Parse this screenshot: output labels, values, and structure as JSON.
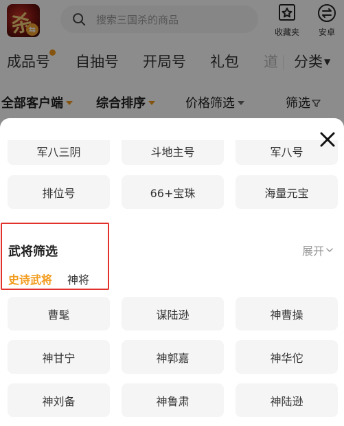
{
  "header": {
    "search_placeholder": "搜索三国杀的商品",
    "actions": [
      {
        "label": "收藏夹",
        "icon": "star-box-icon"
      },
      {
        "label": "安卓",
        "icon": "swap-circle-icon"
      }
    ],
    "logo_glyph": "杀",
    "logo_badge": "⇆"
  },
  "category_tabs": [
    "成品号",
    "自抽号",
    "开局号",
    "礼包",
    "道"
  ],
  "category_more": "分类",
  "filter_row": {
    "client": "全部客户端",
    "sort": "综合排序",
    "price": "价格筛选",
    "filter": "筛选"
  },
  "sheet": {
    "top_partial_chips": [
      "军八三阴",
      "斗地主号",
      "军八号"
    ],
    "tag_chips": [
      "排位号",
      "66+宝珠",
      "海量元宝"
    ],
    "general_section": {
      "title": "武将筛选",
      "expand": "展开",
      "sub_tabs": [
        "史诗武将",
        "神将"
      ],
      "active_sub_tab": "史诗武将"
    },
    "general_chips": [
      "曹髦",
      "谋陆逊",
      "神曹操",
      "神甘宁",
      "神郭嘉",
      "神华佗",
      "神刘备",
      "神鲁肃",
      "神陆逊"
    ]
  },
  "colors": {
    "accent": "#f29a1a",
    "highlight_border": "#e0312b",
    "chip_bg": "#f5f5f5",
    "overlay": "rgba(0,0,0,0.45)"
  }
}
